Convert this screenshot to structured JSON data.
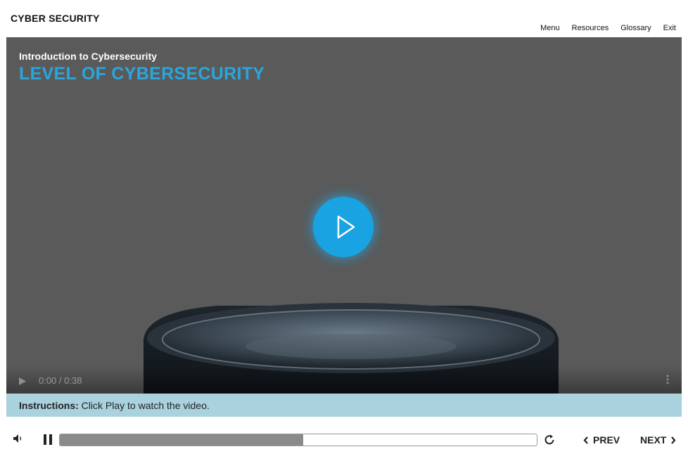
{
  "header": {
    "course_title": "CYBER SECURITY",
    "nav": [
      "Menu",
      "Resources",
      "Glossary",
      "Exit"
    ]
  },
  "slide": {
    "lesson": "Introduction to Cybersecurity",
    "title": "LEVEL OF CYBERSECURITY",
    "accent_color": "#2aa6de"
  },
  "video": {
    "time": "0:00 / 0:38",
    "play_icon": "play-icon",
    "more_icon": "more-vertical-icon"
  },
  "instructions": {
    "label": "Instructions:",
    "text": " Click Play to watch the video."
  },
  "player": {
    "progress": 0.51,
    "prev_label": "PREV",
    "next_label": "NEXT"
  }
}
